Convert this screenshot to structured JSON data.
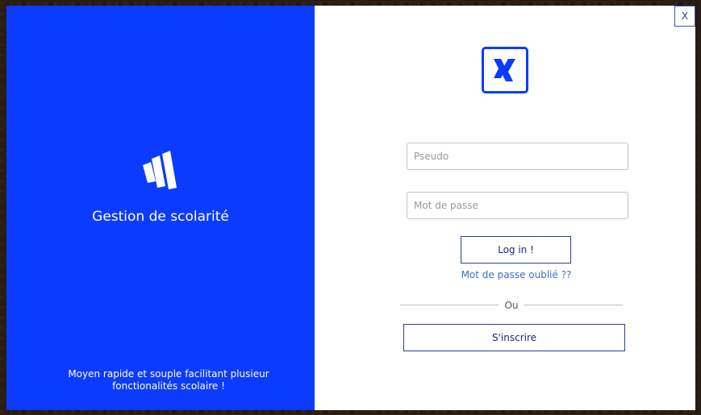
{
  "window": {
    "close_label": "X"
  },
  "left_panel": {
    "brand_icon": "stacked-bars-logo-icon",
    "title": "Gestion de scolarité",
    "tagline_line1": "Moyen rapide et souple facilitant plusieur",
    "tagline_line2": "fonctionalités scolaire !",
    "background_color": "#0b3bff"
  },
  "right_panel": {
    "logo_icon": "x-logo-icon",
    "pseudo_placeholder": "Pseudo",
    "password_placeholder": "Mot de passe",
    "login_label": "Log in !",
    "forgot_password_label": "Mot de passe oublié ??",
    "divider_label": "Ou",
    "signup_label": "S'inscrire",
    "accent_color": "#0b3bff"
  }
}
